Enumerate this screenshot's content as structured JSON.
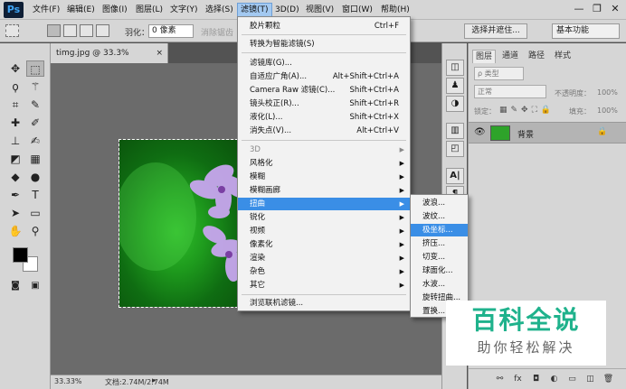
{
  "app": {
    "logo": "Ps"
  },
  "menubar": {
    "items": [
      "文件(F)",
      "编辑(E)",
      "图像(I)",
      "图层(L)",
      "文字(Y)",
      "选择(S)",
      "滤镜(T)",
      "3D(D)",
      "视图(V)",
      "窗口(W)",
      "帮助(H)"
    ],
    "active_index": 6
  },
  "window_controls": {
    "minimize": "—",
    "restore": "❐",
    "close": "✕"
  },
  "options_bar": {
    "feather_label": "羽化：",
    "feather_value": "0 像素",
    "antialias_label": "消除锯齿",
    "select_mask_button": "选择并遮住...",
    "workspace": "基本功能"
  },
  "document": {
    "tab_title": "timg.jpg @ 33.3%(RGB/8#) *",
    "tab_close": "×",
    "zoom": "33.33%",
    "doc_info": "文档:2.74M/2.74M"
  },
  "filter_menu": {
    "items": [
      {
        "label": "胶片颗粒",
        "shortcut": "Ctrl+F"
      },
      {
        "label": "转换为智能滤镜(S)",
        "shortcut": ""
      },
      {
        "label": "滤镜库(G)...",
        "shortcut": ""
      },
      {
        "label": "自适应广角(A)...",
        "shortcut": "Alt+Shift+Ctrl+A"
      },
      {
        "label": "Camera Raw 滤镜(C)...",
        "shortcut": "Shift+Ctrl+A"
      },
      {
        "label": "镜头校正(R)...",
        "shortcut": "Shift+Ctrl+R"
      },
      {
        "label": "液化(L)...",
        "shortcut": "Shift+Ctrl+X"
      },
      {
        "label": "消失点(V)...",
        "shortcut": "Alt+Ctrl+V"
      },
      {
        "label": "3D",
        "shortcut": ""
      },
      {
        "label": "风格化",
        "shortcut": ""
      },
      {
        "label": "模糊",
        "shortcut": ""
      },
      {
        "label": "模糊画廊",
        "shortcut": ""
      },
      {
        "label": "扭曲",
        "shortcut": ""
      },
      {
        "label": "锐化",
        "shortcut": ""
      },
      {
        "label": "视频",
        "shortcut": ""
      },
      {
        "label": "像素化",
        "shortcut": ""
      },
      {
        "label": "渲染",
        "shortcut": ""
      },
      {
        "label": "杂色",
        "shortcut": ""
      },
      {
        "label": "其它",
        "shortcut": ""
      },
      {
        "label": "浏览联机滤镜...",
        "shortcut": ""
      }
    ]
  },
  "distort_submenu": {
    "items": [
      "波浪...",
      "波纹...",
      "极坐标...",
      "挤压...",
      "切变...",
      "球面化...",
      "水波...",
      "旋转扭曲...",
      "置换..."
    ],
    "highlighted_index": 2
  },
  "layers_panel": {
    "tabs": [
      "图层",
      "通道",
      "路径",
      "样式"
    ],
    "kind_filter": "ρ 类型",
    "blend_mode": "正常",
    "opacity_label": "不透明度：",
    "opacity_value": "100%",
    "lock_label": "锁定：",
    "fill_label": "填充：",
    "fill_value": "100%",
    "layer_name": "背景"
  },
  "watermark": {
    "title": "百科全说",
    "subtitle": "助你轻松解决"
  },
  "colors": {
    "accent": "#3a8ee6",
    "menu_highlight": "#a3c9f1",
    "watermark_green": "#1fb28c"
  }
}
